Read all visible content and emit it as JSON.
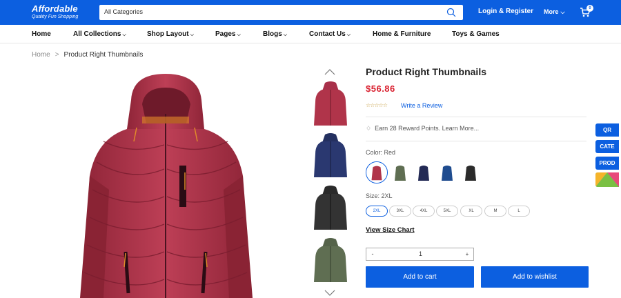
{
  "header": {
    "logo_main": "Affordable",
    "logo_sub": "Quality Fun Shopping",
    "search_placeholder": "All Categories",
    "login_label": "Login & Register",
    "more_label": "More",
    "cart_count": "0"
  },
  "nav": {
    "items": [
      {
        "label": "Home",
        "has_dropdown": false
      },
      {
        "label": "All Collections",
        "has_dropdown": true
      },
      {
        "label": "Shop Layout",
        "has_dropdown": true
      },
      {
        "label": "Pages",
        "has_dropdown": true
      },
      {
        "label": "Blogs",
        "has_dropdown": true
      },
      {
        "label": "Contact Us",
        "has_dropdown": true
      },
      {
        "label": "Home & Furniture",
        "has_dropdown": false
      },
      {
        "label": "Toys & Games",
        "has_dropdown": false
      }
    ]
  },
  "breadcrumb": {
    "home": "Home",
    "separator": ">",
    "current": "Product Right Thumbnails"
  },
  "product": {
    "title": "Product Right Thumbnails",
    "price": "$56.86",
    "rating_stars": "☆☆☆☆☆",
    "review_link": "Write a Review",
    "reward_text": "Earn 28 Reward Points.",
    "reward_link": "Learn More...",
    "color_label": "Color: Red",
    "colors": [
      "red",
      "green",
      "navy",
      "blue",
      "black"
    ],
    "size_label": "Size: 2XL",
    "sizes": [
      "2XL",
      "3XL",
      "4XL",
      "5XL",
      "XL",
      "M",
      "L"
    ],
    "size_chart_link": "View Size Chart",
    "quantity": "1",
    "qty_minus": "-",
    "qty_plus": "+",
    "add_to_cart": "Add to cart",
    "add_to_wishlist": "Add to wishlist"
  },
  "side_tabs": [
    "QR",
    "CATE",
    "PROD"
  ],
  "colors": {
    "brand": "#0c5fe0",
    "price": "#d9202f",
    "jacket_red": "#b0344a"
  }
}
